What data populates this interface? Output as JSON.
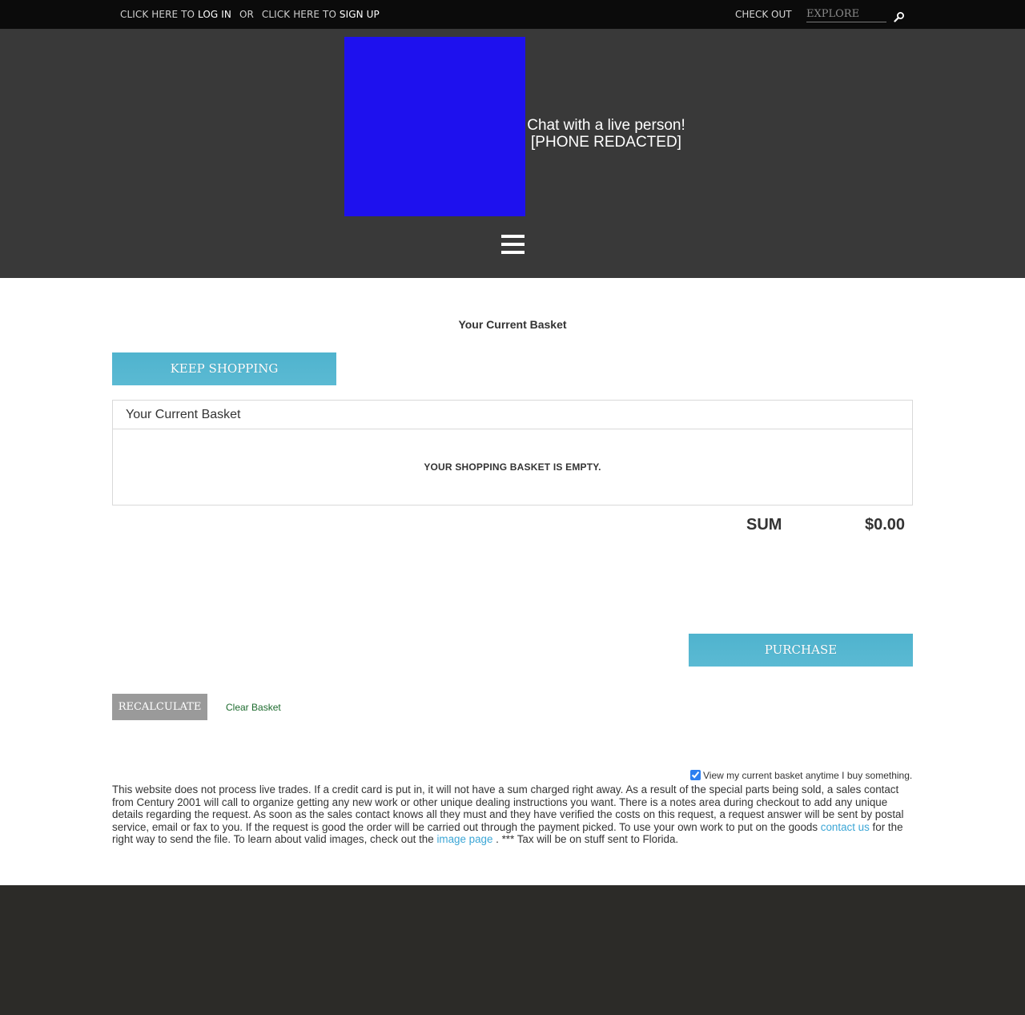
{
  "topbar": {
    "login_prefix": "CLICK HERE TO ",
    "login_label": "LOG IN",
    "or_label": "OR",
    "signup_prefix": "CLICK HERE TO ",
    "signup_label": "SIGN UP",
    "checkout_label": "CHECK OUT",
    "search_placeholder": "EXPLORE"
  },
  "header": {
    "logo_color": "#1e11ee",
    "chat_line1": "Chat with a live person!",
    "chat_line2": "[PHONE REDACTED]"
  },
  "main": {
    "page_title": "Your Current Basket",
    "keep_shopping_label": "KEEP SHOPPING",
    "basket_title": "Your Current Basket",
    "basket_empty_message": "YOUR SHOPPING BASKET IS EMPTY.",
    "sum_label": "SUM",
    "sum_value": "$0.00",
    "purchase_label": "PURCHASE",
    "recalculate_label": "RECALCULATE",
    "clear_basket_label": "Clear Basket",
    "view_basket_checkbox_label": "View my current basket anytime I buy something.",
    "view_basket_checked": true
  },
  "disclaimer": {
    "text1": "This website does not process live trades. If a credit card is put in, it will not have a sum charged right away. As a result of the special parts being sold, a sales contact from Century 2001 will call to organize getting any new work or other unique dealing instructions you want. There is a notes area during checkout to add any unique details regarding the request. As soon as the sales contact knows all they must and they have verified the costs on this request, a request answer will be sent by postal service, email or fax to you. If the request is good the order will be carried out through the payment picked. To use your own work to put on the goods ",
    "contact_link": "contact us",
    "text2": " for the right way to send the file. To learn about valid images, check out the ",
    "image_link": "image page",
    "text3": " . *** Tax will be on stuff sent to Florida."
  },
  "colors": {
    "topbar_bg": "#0b0b0b",
    "header_bg": "#393939",
    "button_blue": "#55b6d0",
    "button_gray": "#9a9a9a",
    "link_blue": "#3ba6d6",
    "link_green": "#1d6b2e",
    "footer_bg": "#2c2b28"
  },
  "icons": {
    "search": "magnifier-icon",
    "menu": "hamburger-menu-icon"
  }
}
